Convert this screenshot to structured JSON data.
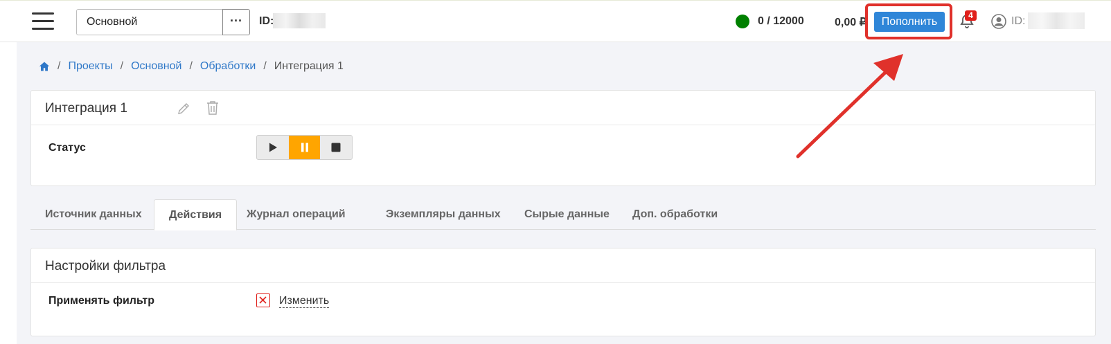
{
  "header": {
    "project_name": "Основной",
    "more_label": "···",
    "id_label": "ID:",
    "quota": "0 / 12000",
    "balance": "0,00 ₽",
    "topup_label": "Пополнить",
    "notification_count": "4",
    "user_id_label": "ID:",
    "status_color": "#008000"
  },
  "breadcrumb": {
    "items": [
      "Проекты",
      "Основной",
      "Обработки"
    ],
    "current": "Интеграция 1"
  },
  "integration": {
    "title": "Интеграция 1",
    "status_label": "Статус",
    "active_control": "pause"
  },
  "tabs": [
    {
      "label": "Источник данных",
      "active": false
    },
    {
      "label": "Действия",
      "active": true
    },
    {
      "label": "Журнал операций",
      "active": false
    },
    {
      "label": "Экземпляры данных",
      "active": false
    },
    {
      "label": "Сырые данные",
      "active": false
    },
    {
      "label": "Доп. обработки",
      "active": false
    }
  ],
  "filter": {
    "title": "Настройки фильтра",
    "apply_label": "Применять фильтр",
    "change_label": "Изменить"
  },
  "colors": {
    "accent": "#2f86d8",
    "link": "#2f78c8",
    "active_control": "#ffa500",
    "highlight": "#e0312b"
  }
}
